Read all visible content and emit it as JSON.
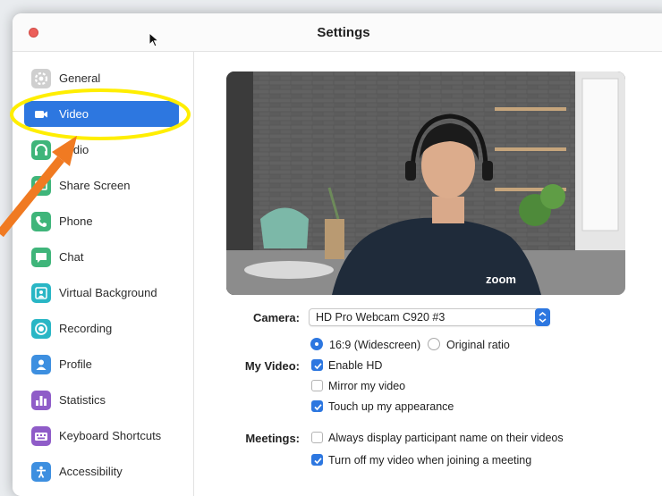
{
  "window": {
    "title": "Settings"
  },
  "sidebar": {
    "items": [
      {
        "label": "General",
        "icon": "gear-icon",
        "color": "#b9b9b9",
        "active": false
      },
      {
        "label": "Video",
        "icon": "video-camera-icon",
        "color": "#ffffff",
        "active": true
      },
      {
        "label": "Audio",
        "icon": "headphones-icon",
        "color": "#3fb57a",
        "active": false
      },
      {
        "label": "Share Screen",
        "icon": "share-screen-icon",
        "color": "#3fb57a",
        "active": false
      },
      {
        "label": "Phone",
        "icon": "phone-icon",
        "color": "#3fb57a",
        "active": false
      },
      {
        "label": "Chat",
        "icon": "chat-bubble-icon",
        "color": "#3fb57a",
        "active": false
      },
      {
        "label": "Virtual Background",
        "icon": "person-background-icon",
        "color": "#29b6c5",
        "active": false
      },
      {
        "label": "Recording",
        "icon": "record-icon",
        "color": "#29b6c5",
        "active": false
      },
      {
        "label": "Profile",
        "icon": "profile-icon",
        "color": "#3d8fe0",
        "active": false
      },
      {
        "label": "Statistics",
        "icon": "bar-chart-icon",
        "color": "#8f5cc8",
        "active": false
      },
      {
        "label": "Keyboard Shortcuts",
        "icon": "keyboard-icon",
        "color": "#8f5cc8",
        "active": false
      },
      {
        "label": "Accessibility",
        "icon": "accessibility-icon",
        "color": "#3d8fe0",
        "active": false
      }
    ]
  },
  "camera": {
    "label": "Camera:",
    "selected": "HD Pro Webcam C920 #3",
    "preview_logo": "zoom"
  },
  "my_video": {
    "label": "My Video:",
    "ratio_wide": "16:9 (Widescreen)",
    "ratio_original": "Original ratio",
    "enable_hd": "Enable HD",
    "mirror": "Mirror my video",
    "touch_up": "Touch up my appearance"
  },
  "meetings": {
    "label": "Meetings:",
    "always_display_name": "Always display participant name on their videos",
    "turn_off_video": "Turn off my video when joining a meeting"
  },
  "colors": {
    "accent": "#2d77e0",
    "highlight_ellipse": "#ffee00",
    "arrow": "#f07a22"
  }
}
